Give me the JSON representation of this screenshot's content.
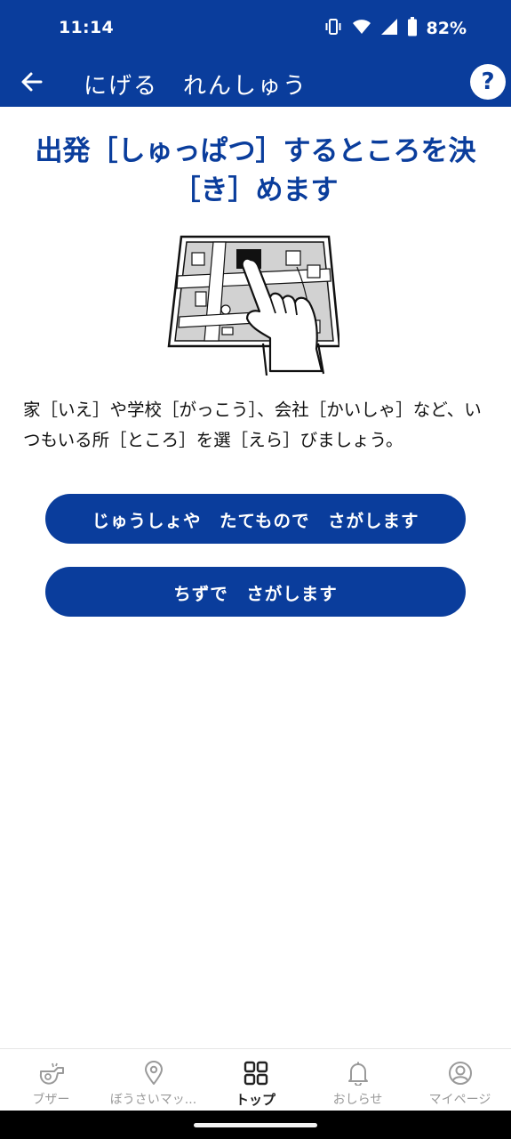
{
  "status_bar": {
    "time": "11:14",
    "battery": "82%"
  },
  "app_bar": {
    "title": "にげる　れんしゅう",
    "help_label": "?"
  },
  "main": {
    "title": "出発［しゅっぱつ］するところを決［き］めます",
    "description": "家［いえ］や学校［がっこう］、会社［かいしゃ］など、いつもいる所［ところ］を選［えら］びましょう。",
    "buttons": [
      {
        "label": "じゅうしょや　たてもので　さがします"
      },
      {
        "label": "ちずで　さがします"
      }
    ]
  },
  "bottom_nav": {
    "items": [
      {
        "label": "ブザー",
        "icon": "whistle-icon",
        "active": false
      },
      {
        "label": "ぼうさいマッ...",
        "icon": "map-pin-icon",
        "active": false
      },
      {
        "label": "トップ",
        "icon": "grid-icon",
        "active": true
      },
      {
        "label": "おしらせ",
        "icon": "bell-icon",
        "active": false
      },
      {
        "label": "マイページ",
        "icon": "user-icon",
        "active": false
      }
    ]
  },
  "colors": {
    "primary": "#0a3d9c",
    "background": "#ffffff",
    "inactive_nav": "#9a9a9a"
  }
}
